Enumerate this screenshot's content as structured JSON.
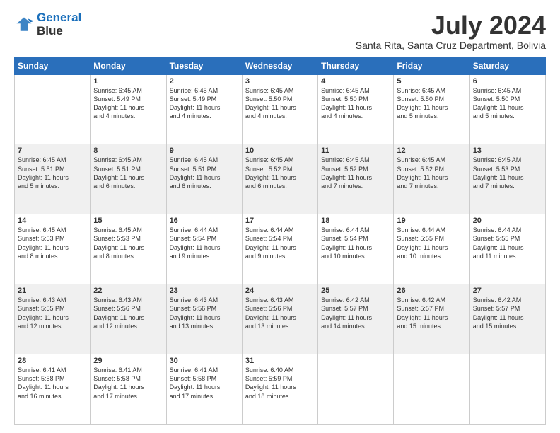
{
  "header": {
    "logo_line1": "General",
    "logo_line2": "Blue",
    "month_year": "July 2024",
    "location": "Santa Rita, Santa Cruz Department, Bolivia"
  },
  "days_of_week": [
    "Sunday",
    "Monday",
    "Tuesday",
    "Wednesday",
    "Thursday",
    "Friday",
    "Saturday"
  ],
  "weeks": [
    [
      {
        "day": "",
        "info": ""
      },
      {
        "day": "1",
        "info": "Sunrise: 6:45 AM\nSunset: 5:49 PM\nDaylight: 11 hours\nand 4 minutes."
      },
      {
        "day": "2",
        "info": "Sunrise: 6:45 AM\nSunset: 5:49 PM\nDaylight: 11 hours\nand 4 minutes."
      },
      {
        "day": "3",
        "info": "Sunrise: 6:45 AM\nSunset: 5:50 PM\nDaylight: 11 hours\nand 4 minutes."
      },
      {
        "day": "4",
        "info": "Sunrise: 6:45 AM\nSunset: 5:50 PM\nDaylight: 11 hours\nand 4 minutes."
      },
      {
        "day": "5",
        "info": "Sunrise: 6:45 AM\nSunset: 5:50 PM\nDaylight: 11 hours\nand 5 minutes."
      },
      {
        "day": "6",
        "info": "Sunrise: 6:45 AM\nSunset: 5:50 PM\nDaylight: 11 hours\nand 5 minutes."
      }
    ],
    [
      {
        "day": "7",
        "info": "Sunrise: 6:45 AM\nSunset: 5:51 PM\nDaylight: 11 hours\nand 5 minutes."
      },
      {
        "day": "8",
        "info": "Sunrise: 6:45 AM\nSunset: 5:51 PM\nDaylight: 11 hours\nand 6 minutes."
      },
      {
        "day": "9",
        "info": "Sunrise: 6:45 AM\nSunset: 5:51 PM\nDaylight: 11 hours\nand 6 minutes."
      },
      {
        "day": "10",
        "info": "Sunrise: 6:45 AM\nSunset: 5:52 PM\nDaylight: 11 hours\nand 6 minutes."
      },
      {
        "day": "11",
        "info": "Sunrise: 6:45 AM\nSunset: 5:52 PM\nDaylight: 11 hours\nand 7 minutes."
      },
      {
        "day": "12",
        "info": "Sunrise: 6:45 AM\nSunset: 5:52 PM\nDaylight: 11 hours\nand 7 minutes."
      },
      {
        "day": "13",
        "info": "Sunrise: 6:45 AM\nSunset: 5:53 PM\nDaylight: 11 hours\nand 7 minutes."
      }
    ],
    [
      {
        "day": "14",
        "info": "Sunrise: 6:45 AM\nSunset: 5:53 PM\nDaylight: 11 hours\nand 8 minutes."
      },
      {
        "day": "15",
        "info": "Sunrise: 6:45 AM\nSunset: 5:53 PM\nDaylight: 11 hours\nand 8 minutes."
      },
      {
        "day": "16",
        "info": "Sunrise: 6:44 AM\nSunset: 5:54 PM\nDaylight: 11 hours\nand 9 minutes."
      },
      {
        "day": "17",
        "info": "Sunrise: 6:44 AM\nSunset: 5:54 PM\nDaylight: 11 hours\nand 9 minutes."
      },
      {
        "day": "18",
        "info": "Sunrise: 6:44 AM\nSunset: 5:54 PM\nDaylight: 11 hours\nand 10 minutes."
      },
      {
        "day": "19",
        "info": "Sunrise: 6:44 AM\nSunset: 5:55 PM\nDaylight: 11 hours\nand 10 minutes."
      },
      {
        "day": "20",
        "info": "Sunrise: 6:44 AM\nSunset: 5:55 PM\nDaylight: 11 hours\nand 11 minutes."
      }
    ],
    [
      {
        "day": "21",
        "info": "Sunrise: 6:43 AM\nSunset: 5:55 PM\nDaylight: 11 hours\nand 12 minutes."
      },
      {
        "day": "22",
        "info": "Sunrise: 6:43 AM\nSunset: 5:56 PM\nDaylight: 11 hours\nand 12 minutes."
      },
      {
        "day": "23",
        "info": "Sunrise: 6:43 AM\nSunset: 5:56 PM\nDaylight: 11 hours\nand 13 minutes."
      },
      {
        "day": "24",
        "info": "Sunrise: 6:43 AM\nSunset: 5:56 PM\nDaylight: 11 hours\nand 13 minutes."
      },
      {
        "day": "25",
        "info": "Sunrise: 6:42 AM\nSunset: 5:57 PM\nDaylight: 11 hours\nand 14 minutes."
      },
      {
        "day": "26",
        "info": "Sunrise: 6:42 AM\nSunset: 5:57 PM\nDaylight: 11 hours\nand 15 minutes."
      },
      {
        "day": "27",
        "info": "Sunrise: 6:42 AM\nSunset: 5:57 PM\nDaylight: 11 hours\nand 15 minutes."
      }
    ],
    [
      {
        "day": "28",
        "info": "Sunrise: 6:41 AM\nSunset: 5:58 PM\nDaylight: 11 hours\nand 16 minutes."
      },
      {
        "day": "29",
        "info": "Sunrise: 6:41 AM\nSunset: 5:58 PM\nDaylight: 11 hours\nand 17 minutes."
      },
      {
        "day": "30",
        "info": "Sunrise: 6:41 AM\nSunset: 5:58 PM\nDaylight: 11 hours\nand 17 minutes."
      },
      {
        "day": "31",
        "info": "Sunrise: 6:40 AM\nSunset: 5:59 PM\nDaylight: 11 hours\nand 18 minutes."
      },
      {
        "day": "",
        "info": ""
      },
      {
        "day": "",
        "info": ""
      },
      {
        "day": "",
        "info": ""
      }
    ]
  ]
}
